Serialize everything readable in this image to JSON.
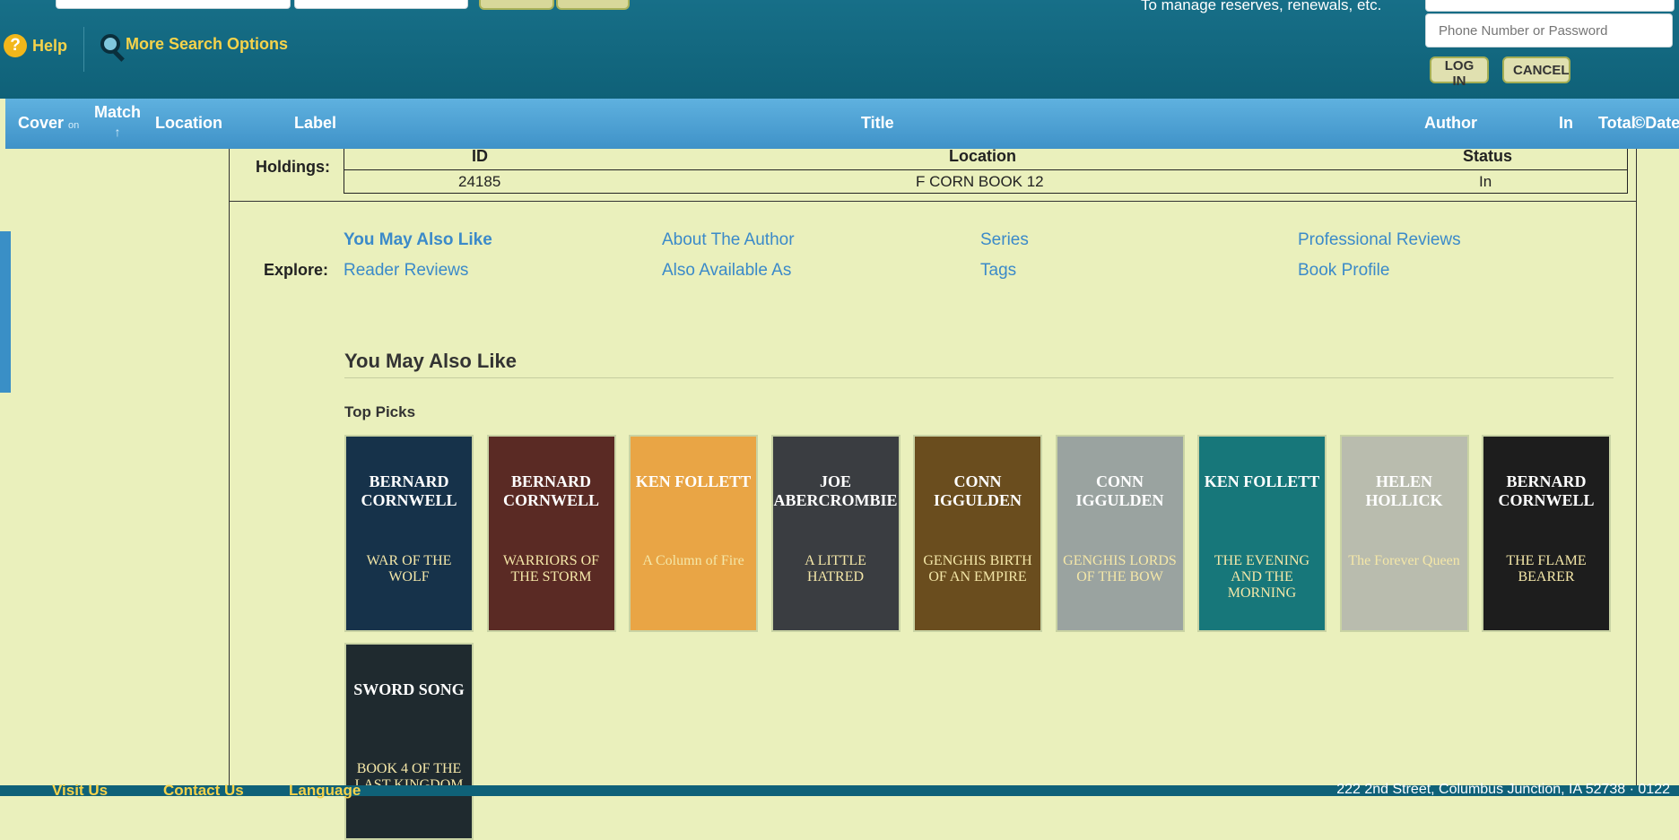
{
  "topbar": {
    "help_label": "Help",
    "more_search_label": "More Search Options",
    "manage_text": "To manage reserves, renewals, etc.",
    "password_placeholder": "Phone Number or Password",
    "login_label": "LOG IN",
    "cancel_label": "CANCEL"
  },
  "columns": {
    "cover": "Cover",
    "cover_toggle": "on",
    "match": "Match",
    "match_sort": "↑",
    "location": "Location",
    "label": "Label",
    "title": "Title",
    "author": "Author",
    "in": "In",
    "total": "Total",
    "date": "©Date"
  },
  "holdings": {
    "label": "Holdings:",
    "headers": [
      "ID",
      "Location",
      "Status"
    ],
    "rows": [
      {
        "id": "24185",
        "location": "F CORN BOOK 12",
        "status": "In"
      }
    ]
  },
  "explore": {
    "label": "Explore:",
    "links": [
      "You May Also Like",
      "About The Author",
      "Series",
      "Professional Reviews",
      "Reader Reviews",
      "Also Available As",
      "Tags",
      "Book Profile"
    ]
  },
  "recommendations": {
    "title": "You May Also Like",
    "subtitle": "Top Picks",
    "books": [
      {
        "author": "BERNARD CORNWELL",
        "title": "WAR OF THE WOLF",
        "color": "#16324a"
      },
      {
        "author": "BERNARD CORNWELL",
        "title": "WARRIORS OF THE STORM",
        "color": "#5a2a24"
      },
      {
        "author": "KEN FOLLETT",
        "title": "A Column of Fire",
        "color": "#e9a545"
      },
      {
        "author": "JOE ABERCROMBIE",
        "title": "A LITTLE HATRED",
        "color": "#3a3d41"
      },
      {
        "author": "CONN IGGULDEN",
        "title": "GENGHIS BIRTH OF AN EMPIRE",
        "color": "#6a4d1e"
      },
      {
        "author": "CONN IGGULDEN",
        "title": "GENGHIS LORDS OF THE BOW",
        "color": "#9aa3a0"
      },
      {
        "author": "KEN FOLLETT",
        "title": "THE EVENING AND THE MORNING",
        "color": "#17777a"
      },
      {
        "author": "HELEN HOLLICK",
        "title": "The Forever Queen",
        "color": "#b9bcae"
      },
      {
        "author": "BERNARD CORNWELL",
        "title": "THE FLAME BEARER",
        "color": "#1d1d1d"
      },
      {
        "author": "SWORD SONG",
        "title": "BOOK 4 OF THE LAST KINGDOM",
        "color": "#1f2a2f"
      }
    ]
  },
  "footer": {
    "visit": "Visit Us",
    "contact": "Contact Us",
    "language": "Language",
    "address": "222 2nd Street, Columbus Junction, IA 52738 · 0122"
  }
}
